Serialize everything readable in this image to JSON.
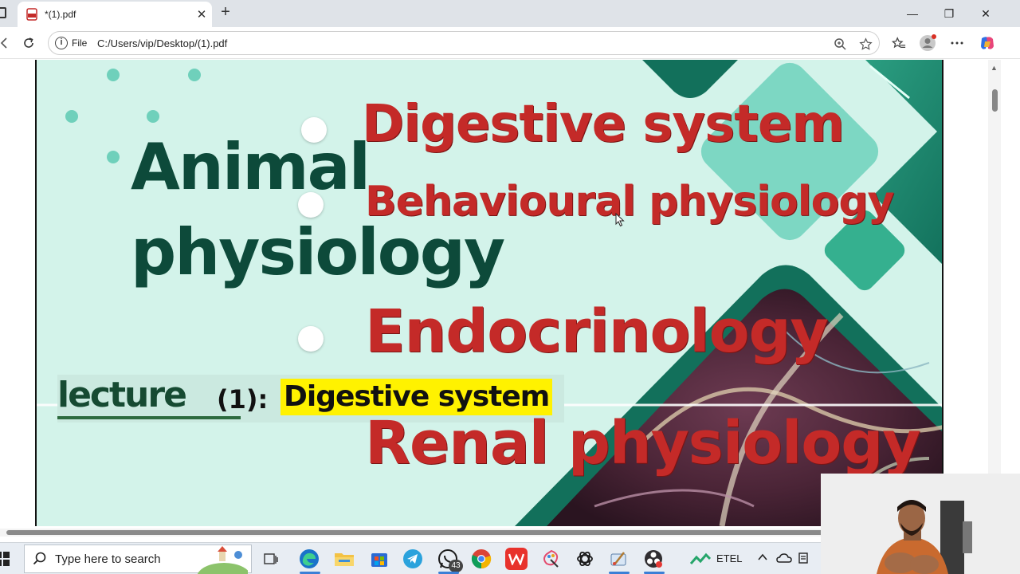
{
  "browser": {
    "tab_title": "*(1).pdf",
    "new_tab_glyph": "+",
    "close_tab_glyph": "✕",
    "file_label": "File",
    "url": "C:/Users/vip/Desktop/(1).pdf",
    "window_controls": {
      "minimize": "—",
      "restore": "❐",
      "close": "✕"
    }
  },
  "pdf_page": {
    "title_line1": "Animal",
    "title_line2": "physiology",
    "topics": [
      "Digestive system",
      "Behavioural physiology",
      "Endocrinology",
      "Renal physiology"
    ],
    "lecture_word": "lecture",
    "lecture_number": "(1):",
    "lecture_topic": "Digestive system",
    "colors": {
      "background": "#d3f3ea",
      "title": "#0d4a3a",
      "topic_red": "#c42a28",
      "highlight": "#fff200",
      "accent_teal": "#2fa587",
      "dark_teal": "#12705b"
    }
  },
  "taskbar": {
    "search_placeholder": "Type here to search",
    "whatsapp_badge": "43",
    "tray_label": "ETEL",
    "icons": [
      "windows-start-icon",
      "search-icon",
      "task-view-icon",
      "edge-icon",
      "file-explorer-icon",
      "store-icon",
      "telegram-icon",
      "whatsapp-icon",
      "chrome-icon",
      "wps-icon",
      "paint-icon",
      "chatgpt-icon",
      "paint-brush-icon",
      "obs-icon"
    ]
  }
}
